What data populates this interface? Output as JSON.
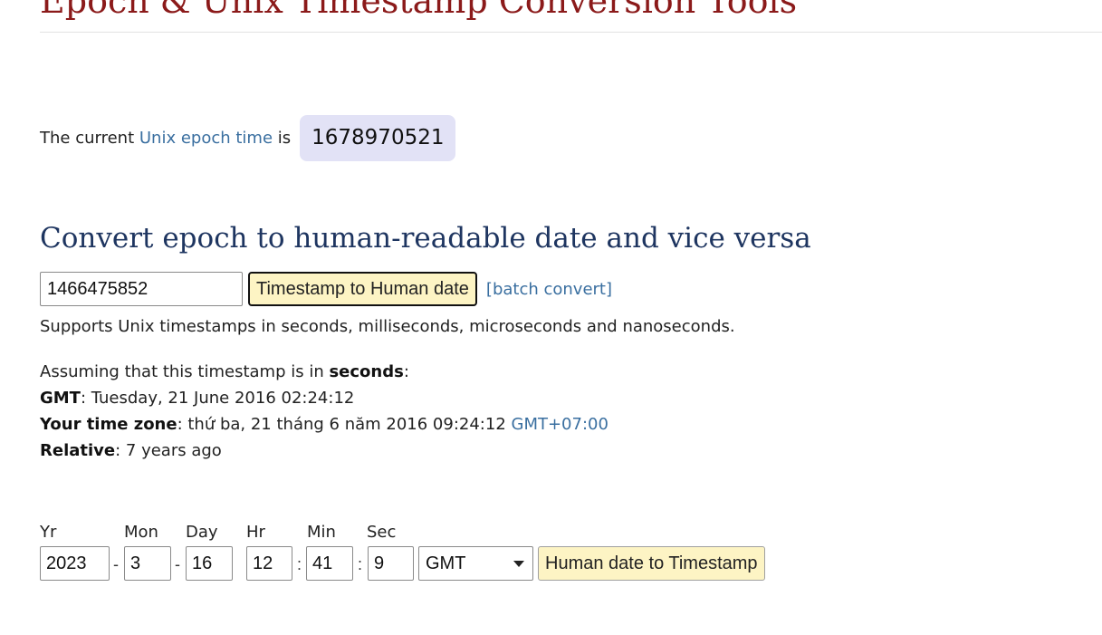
{
  "site": {
    "title": "Epoch & Unix Timestamp Conversion Tools"
  },
  "current": {
    "prefix": "The current ",
    "link_text": "Unix epoch time",
    "suffix": " is",
    "epoch_value": "1678970521"
  },
  "converter": {
    "heading": "Convert epoch to human-readable date and vice versa",
    "input_value": "1466475852",
    "button_label": "Timestamp to Human date",
    "batch_link": "[batch convert]",
    "supports_text": "Supports Unix timestamps in seconds, milliseconds, microseconds and nanoseconds."
  },
  "result": {
    "assuming_prefix": "Assuming that this timestamp is in ",
    "assuming_unit": "seconds",
    "assuming_suffix": ":",
    "gmt_label": "GMT",
    "gmt_value": ": Tuesday, 21 June 2016 02:24:12",
    "tz_label": "Your time zone",
    "tz_value": ": thứ ba, 21 tháng 6 năm 2016 09:24:12 ",
    "tz_offset": "GMT+07:00",
    "relative_label": "Relative",
    "relative_value": ": 7 years ago"
  },
  "date_form": {
    "labels": {
      "yr": "Yr",
      "mon": "Mon",
      "day": "Day",
      "hr": "Hr",
      "min": "Min",
      "sec": "Sec"
    },
    "values": {
      "yr": "2023",
      "mon": "3",
      "day": "16",
      "hr": "12",
      "min": "41",
      "sec": "9"
    },
    "separators": {
      "date": "-",
      "time": ":"
    },
    "timezone": "GMT",
    "button_label": "Human date to Timestamp"
  },
  "colors": {
    "title": "#8b1a1a",
    "heading": "#1e3560",
    "link": "#3a6fa0",
    "epoch_box_bg": "#e2e2f6",
    "button_bg": "#fdf4c4"
  },
  "icons": {
    "select_caret": "chevron-down-icon"
  }
}
